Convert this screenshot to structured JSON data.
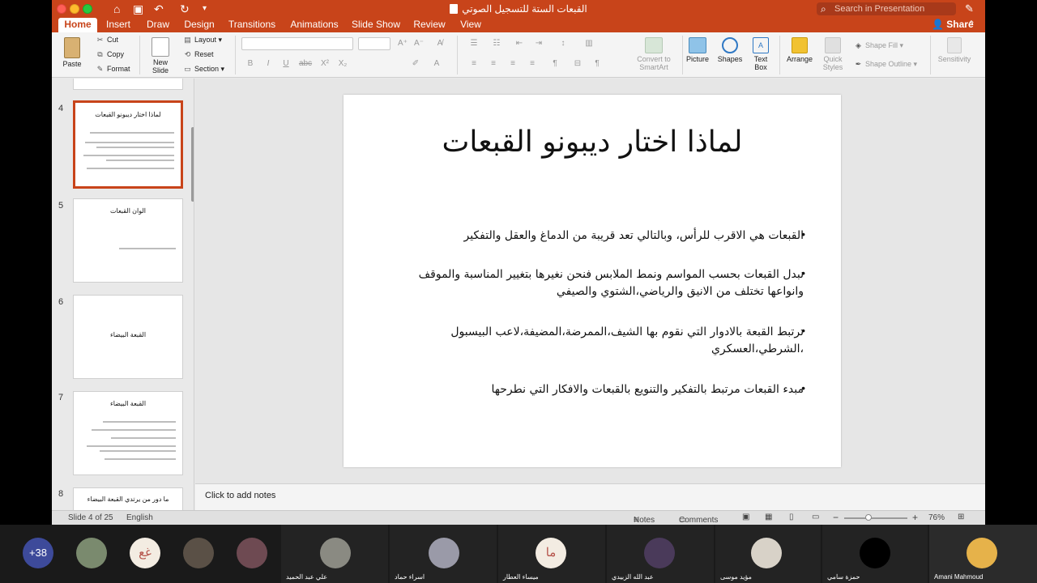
{
  "window": {
    "title": "القبعات الستة للتسجيل الصوتي",
    "search_placeholder": "Search in Presentation"
  },
  "tabs": [
    "Home",
    "Insert",
    "Draw",
    "Design",
    "Transitions",
    "Animations",
    "Slide Show",
    "Review",
    "View"
  ],
  "active_tab": "Home",
  "share_label": "Share",
  "ribbon": {
    "paste": "Paste",
    "cut": "Cut",
    "copy": "Copy",
    "format": "Format",
    "new_slide": "New Slide",
    "layout": "Layout",
    "reset": "Reset",
    "section": "Section",
    "format_buttons": [
      "B",
      "I",
      "U",
      "abc",
      "X²",
      "X₂"
    ],
    "convert_smartart": "Convert to SmartArt",
    "picture": "Picture",
    "shapes": "Shapes",
    "text_box": "Text Box",
    "arrange": "Arrange",
    "quick_styles": "Quick Styles",
    "shape_fill": "Shape Fill",
    "shape_outline": "Shape Outline",
    "sensitivity": "Sensitivity"
  },
  "thumbnails": [
    {
      "num": "4",
      "title": "لماذا اختار ديبونو القبعات",
      "selected": true
    },
    {
      "num": "5",
      "title": "الوان القبعات"
    },
    {
      "num": "6",
      "title": "القبعة البيضاء"
    },
    {
      "num": "7",
      "title": "القبعة البيضاء"
    },
    {
      "num": "8",
      "title": "ما دور من يرتدي القبعة البيضاء"
    }
  ],
  "slide": {
    "title": "لماذا اختار ديبونو القبعات",
    "bullets": [
      "القبعات هي الاقرب للرأس، وبالتالي تعد قريبة من الدماغ والعقل والتفكير",
      "نبدل القبعات بحسب المواسم ونمط الملابس فنحن نغيرها بتغيير المناسبة والموقف وانواعها تختلف من الانيق والرياضي،الشتوي والصيفي",
      "ترتبط القبعة بالادوار التي نقوم بها الشيف،الممرضة،المضيفة،لاعب البيسبول ،الشرطي،العسكري",
      "مبدء القبعات مرتبط بالتفكير والتنويع بالقبعات والافكار التي نطرحها"
    ]
  },
  "notes_placeholder": "Click to add notes",
  "status": {
    "slide_info": "Slide 4 of 25",
    "language": "English",
    "notes": "Notes",
    "comments": "Comments",
    "zoom": "76%"
  },
  "participants": {
    "more_count": "+38",
    "avatars": [
      {
        "initials": "غع",
        "color": "#f3ece2",
        "text_color": "#b5534a"
      },
      {
        "initials": "ما",
        "color": "#f3ece2",
        "text_color": "#b5534a"
      }
    ],
    "names": [
      "علي عبد الحميد",
      "اسراء حماد",
      "ميساء العطار",
      "عبد الله الزبيدي",
      "مؤيد موسى",
      "حمزة سامي",
      "Amani Mahmoud"
    ]
  },
  "colors": {
    "accent": "#c8441a",
    "ribbon_bg": "#f4f4f4"
  }
}
